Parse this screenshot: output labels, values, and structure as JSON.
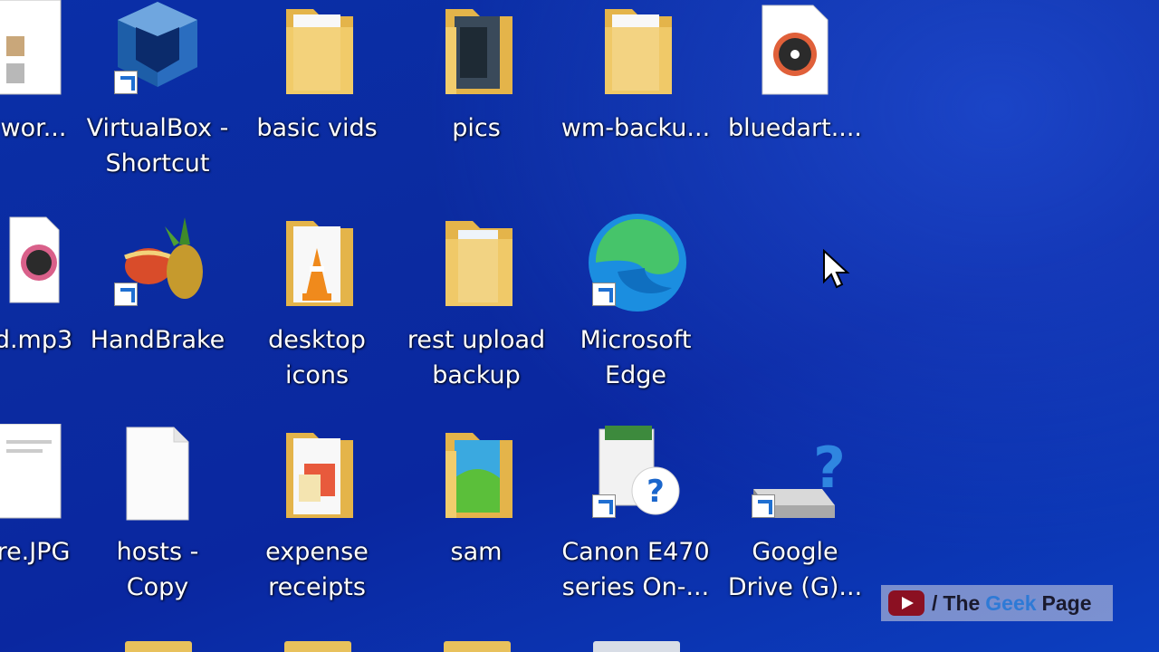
{
  "desktop": {
    "icons": [
      {
        "label": "wor...",
        "icon": "document-thumbnail-icon"
      },
      {
        "label": "VirtualBox -\nShortcut",
        "icon": "virtualbox-icon",
        "shortcut": true
      },
      {
        "label": "basic vids",
        "icon": "folder-icon"
      },
      {
        "label": "pics",
        "icon": "folder-photo-icon"
      },
      {
        "label": "wm-backu...",
        "icon": "folder-icon"
      },
      {
        "label": "bluedart....",
        "icon": "audio-file-icon"
      },
      {
        "label": "d.mp3",
        "icon": "audio-file-icon"
      },
      {
        "label": "HandBrake",
        "icon": "handbrake-icon",
        "shortcut": true
      },
      {
        "label": "desktop\nicons",
        "icon": "folder-vlc-icon"
      },
      {
        "label": "rest upload\nbackup",
        "icon": "folder-icon"
      },
      {
        "label": "Microsoft\nEdge",
        "icon": "edge-icon",
        "shortcut": true
      },
      {
        "label": "re.JPG",
        "icon": "image-file-icon"
      },
      {
        "label": "hosts -\nCopy",
        "icon": "blank-file-icon"
      },
      {
        "label": "expense\nreceipts",
        "icon": "folder-icon"
      },
      {
        "label": "sam",
        "icon": "folder-photo-icon"
      },
      {
        "label": "Canon E470\nseries On-...",
        "icon": "help-book-icon",
        "shortcut": true
      },
      {
        "label": "Google\nDrive (G)...",
        "icon": "drive-help-icon",
        "shortcut": true
      }
    ]
  },
  "watermark": {
    "slash": "/",
    "the": "The",
    "geek": "Geek",
    "page": "Page"
  },
  "colors": {
    "desktop": "#0b2ba0",
    "folder": "#f2cd6d",
    "accent": "#2e7ad6"
  }
}
